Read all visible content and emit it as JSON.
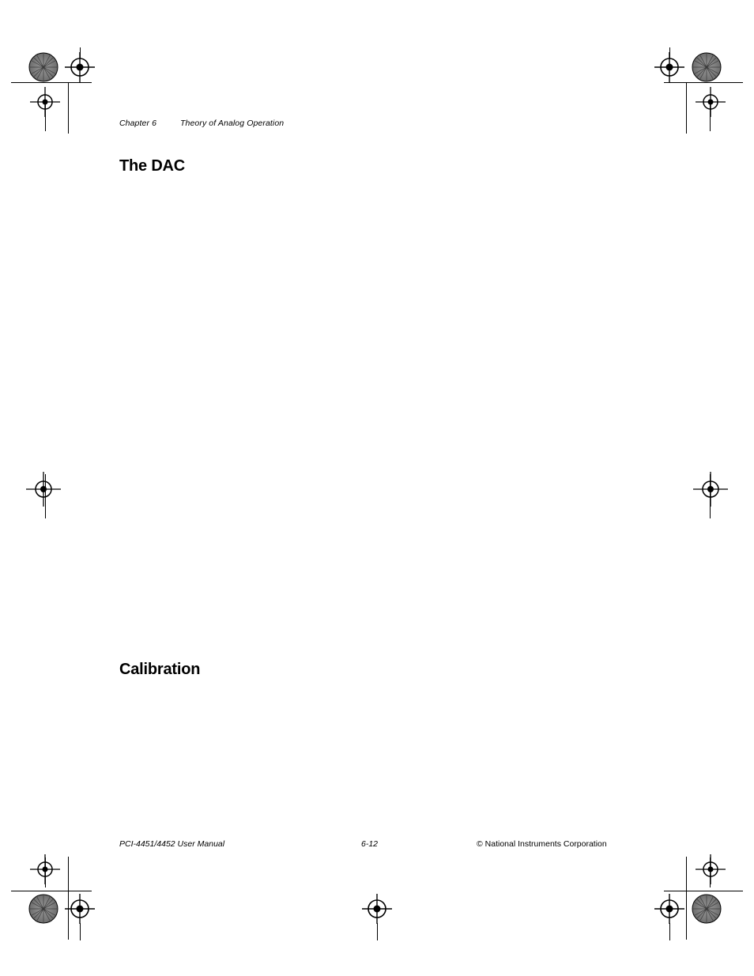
{
  "document": {
    "running_head": {
      "chapter": "Chapter 6",
      "title": "Theory of Analog Operation"
    },
    "headings": {
      "the_dac": "The DAC",
      "calibration": "Calibration"
    },
    "footer": {
      "left": "PCI-4451/4452 User Manual",
      "center": "6-12",
      "right": "© National Instruments Corporation"
    }
  },
  "press_marks": {
    "halftone_icon": "halftone-dot-circle",
    "crosshair_icon": "registration-crosshair",
    "trim_rule_icon": "trim-rule-line"
  }
}
